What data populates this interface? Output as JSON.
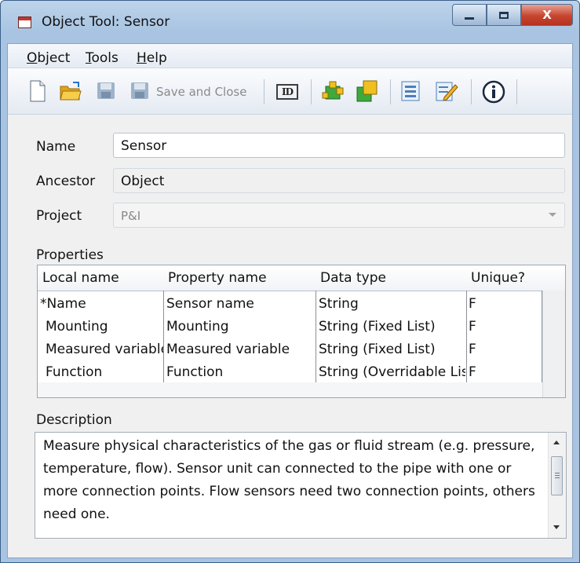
{
  "window": {
    "title": "Object Tool: Sensor",
    "icon": "app-window-icon",
    "controls": {
      "minimize": "minimize-icon",
      "maximize": "maximize-icon",
      "close": "X"
    }
  },
  "menu": {
    "items": [
      {
        "underline": "O",
        "rest": "bject"
      },
      {
        "underline": "T",
        "rest": "ools"
      },
      {
        "underline": "H",
        "rest": "elp"
      }
    ]
  },
  "toolbar": {
    "save_and_close_label": "Save and Close",
    "id_label": "ID",
    "icons": [
      "new-document-icon",
      "open-folder-icon",
      "save-icon",
      "save-and-close-icon",
      "id-icon",
      "edit-connection-points-icon",
      "shapes-icon",
      "form-icon",
      "edit-form-icon",
      "info-icon"
    ]
  },
  "form": {
    "name_label": "Name",
    "name_value": "Sensor",
    "ancestor_label": "Ancestor",
    "ancestor_value": "Object",
    "project_label": "Project",
    "project_value": "P&I",
    "properties_label": "Properties",
    "description_label": "Description",
    "description_text": "Measure physical characteristics of the gas or fluid stream (e.g. pressure, temperature, flow). Sensor unit can connected to the pipe with one or more connection points. Flow sensors need two connection points, others need one."
  },
  "properties_table": {
    "columns": [
      "Local name",
      "Property name",
      "Data type",
      "Unique?"
    ],
    "rows": [
      [
        "*Name",
        "Sensor name",
        "String",
        "F"
      ],
      [
        " Mounting",
        "Mounting",
        "String (Fixed List)",
        "F"
      ],
      [
        " Measured variable",
        "Measured variable",
        "String (Fixed List)",
        "F"
      ],
      [
        " Function",
        "Function",
        "String (Overridable List)",
        "F"
      ]
    ]
  },
  "colors": {
    "title_bar": "#a9c4e2",
    "close_button": "#c7452f",
    "client_background": "#f0f0f0"
  }
}
